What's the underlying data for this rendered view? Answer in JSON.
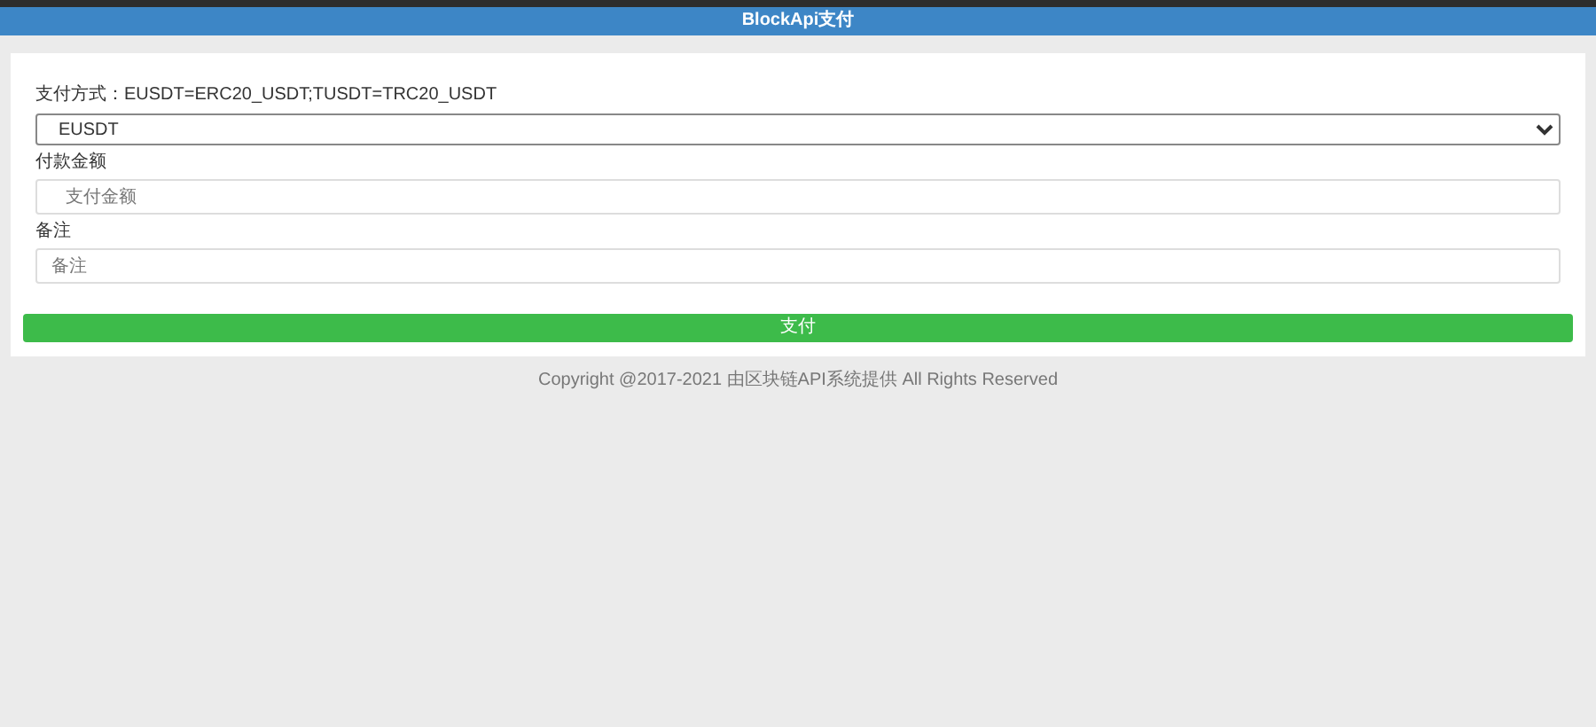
{
  "header": {
    "title": "BlockApi支付"
  },
  "form": {
    "method_label": "支付方式：EUSDT=ERC20_USDT;TUSDT=TRC20_USDT",
    "method_select": {
      "value": "EUSDT"
    },
    "amount_label": "付款金额",
    "amount_field": {
      "placeholder": "支付金额"
    },
    "note_label": "备注",
    "note_field": {
      "placeholder": "备注"
    },
    "submit_button": "支付"
  },
  "footer": "Copyright @2017-2021 由区块链API系统提供 All Rights Reserved"
}
